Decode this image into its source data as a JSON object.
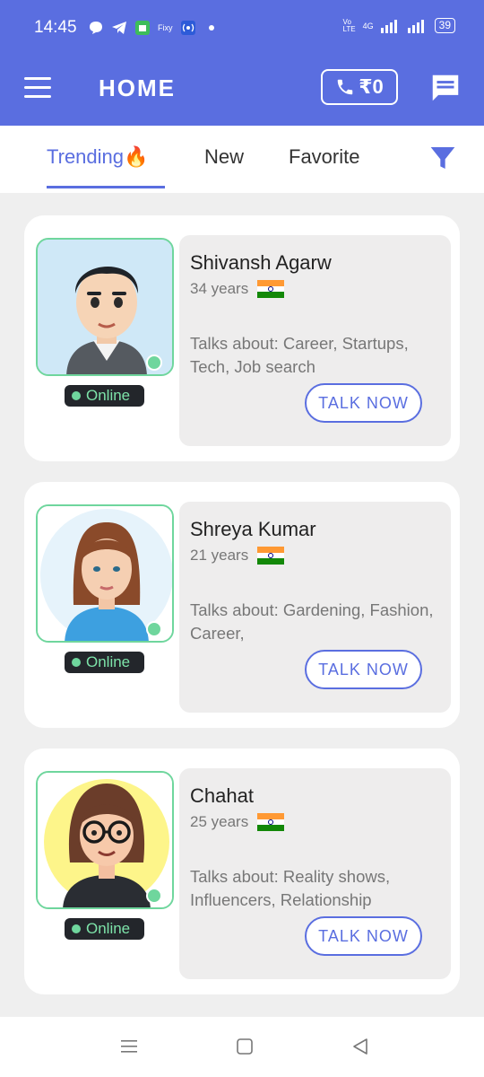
{
  "status_bar": {
    "time": "14:45",
    "left_icons": [
      "chat-bubble-icon",
      "telegram-icon",
      "app-icon",
      "fixy-icon",
      "hotspot-icon",
      "dot-icon"
    ],
    "fixy_label": "Fixy",
    "network": "4G",
    "battery": "39"
  },
  "app_bar": {
    "title": "HOME",
    "wallet_amount": "₹0"
  },
  "tabs": [
    {
      "label": "Trending🔥",
      "active": true
    },
    {
      "label": "New",
      "active": false
    },
    {
      "label": "Favorite",
      "active": false
    }
  ],
  "cards": [
    {
      "name": "Shivansh Agarw",
      "age": "34 years",
      "talks_about": "Talks about: Career, Startups, Tech, Job search",
      "status": "Online",
      "button": "TALK NOW"
    },
    {
      "name": "Shreya Kumar",
      "age": "21 years",
      "talks_about": "Talks about: Gardening, Fashion, Career,",
      "status": "Online",
      "button": "TALK NOW"
    },
    {
      "name": "Chahat",
      "age": "25 years",
      "talks_about": "Talks about: Reality shows, Influencers, Relationship",
      "status": "Online",
      "button": "TALK NOW"
    }
  ],
  "colors": {
    "primary": "#5a6ee0",
    "online": "#6fd69d",
    "card_info_bg": "#eeeded",
    "page_bg": "#efefef"
  },
  "nav_bar": {
    "items": [
      "menu-icon",
      "home-square-icon",
      "back-triangle-icon"
    ]
  }
}
